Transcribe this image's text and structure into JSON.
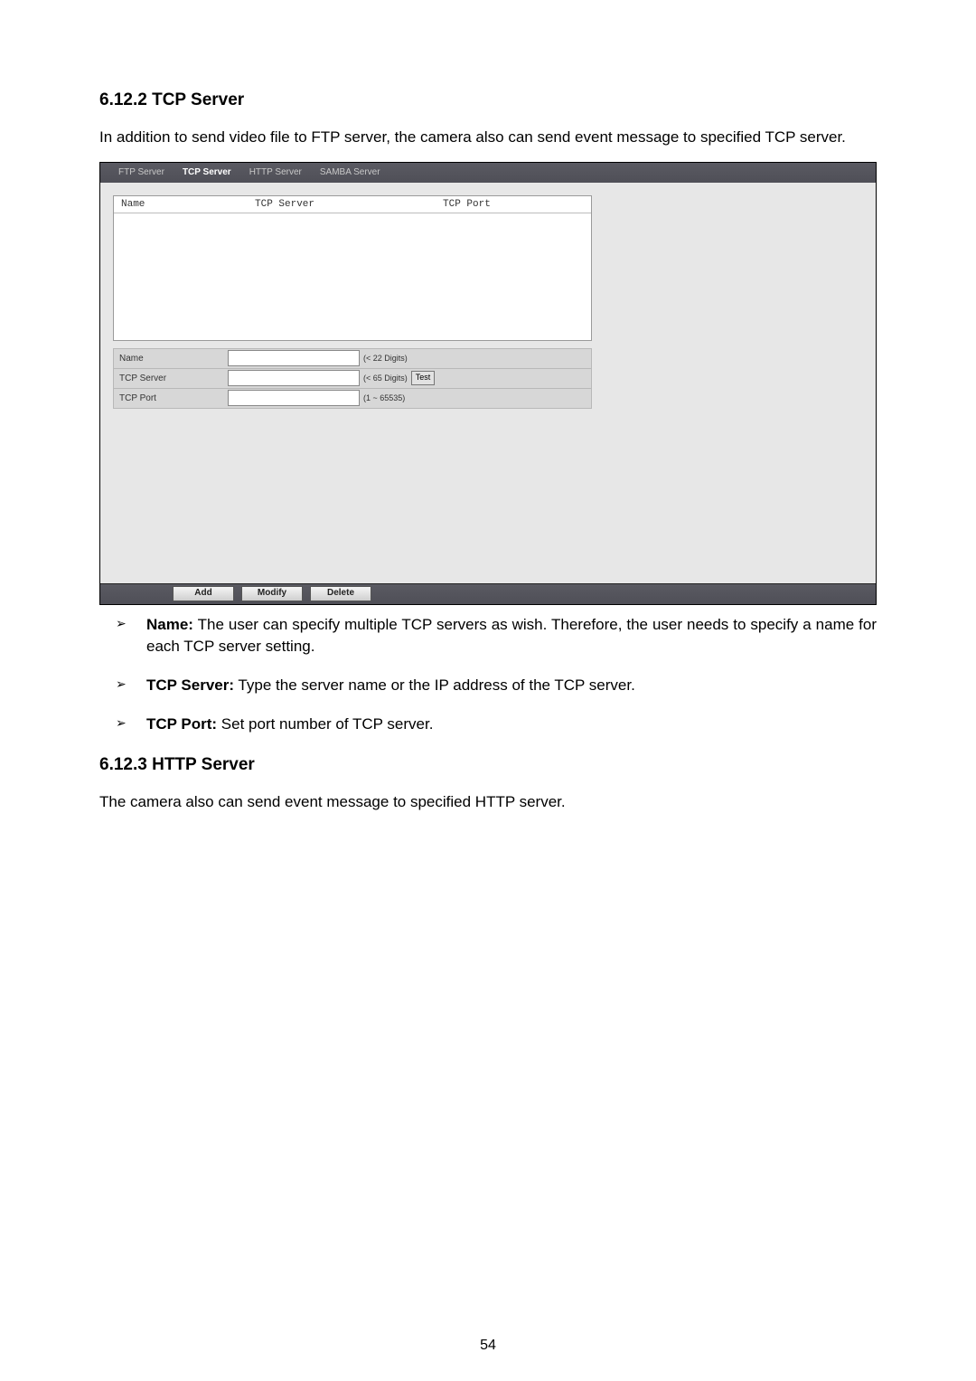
{
  "section1": {
    "heading": "6.12.2 TCP Server",
    "intro": "In addition to send video file to FTP server, the camera also can send event message to specified TCP server."
  },
  "ui": {
    "tabs": [
      {
        "label": "FTP Server",
        "active": false
      },
      {
        "label": "TCP Server",
        "active": true
      },
      {
        "label": "HTTP Server",
        "active": false
      },
      {
        "label": "SAMBA Server",
        "active": false
      }
    ],
    "list_headers": {
      "col1": "Name",
      "col2": "TCP Server",
      "col3": "TCP Port"
    },
    "form": {
      "name": {
        "label": "Name",
        "hint": "(< 22 Digits)",
        "value": ""
      },
      "server": {
        "label": "TCP Server",
        "hint": "(< 65 Digits)",
        "test_label": "Test",
        "value": ""
      },
      "port": {
        "label": "TCP Port",
        "hint": "(1 ~ 65535)",
        "value": ""
      }
    },
    "buttons": {
      "add": "Add",
      "modify": "Modify",
      "delete": "Delete"
    }
  },
  "bullets": [
    {
      "term": "Name:",
      "desc": " The user can specify multiple TCP servers as wish. Therefore, the user needs to specify a name for each TCP server setting."
    },
    {
      "term": "TCP Server:",
      "desc": " Type the server name or the IP address of the TCP server."
    },
    {
      "term": "TCP Port:",
      "desc": " Set port number of TCP server."
    }
  ],
  "section2": {
    "heading": "6.12.3 HTTP Server",
    "intro": "The camera also can send event message to specified HTTP server."
  },
  "page_number": "54"
}
